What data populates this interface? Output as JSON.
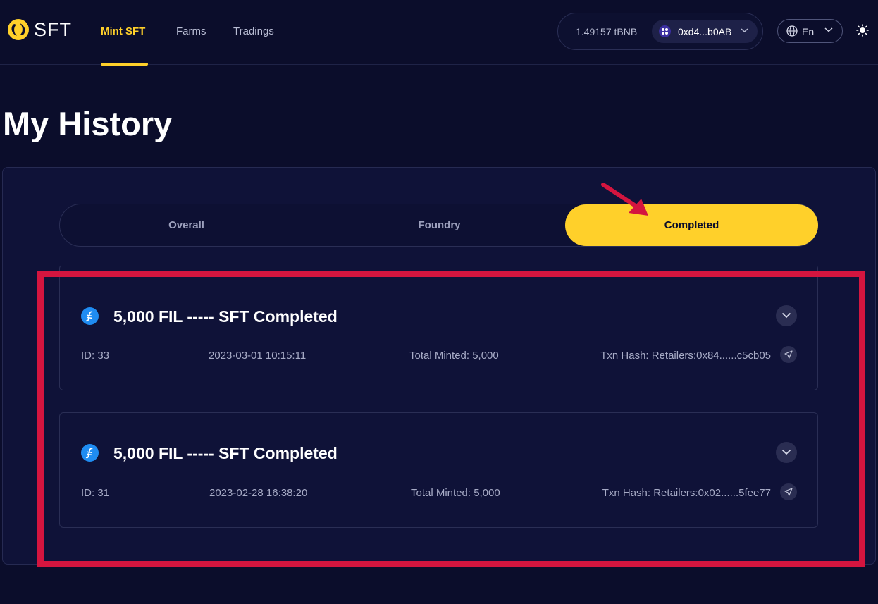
{
  "header": {
    "logo_text": "SFT",
    "nav": [
      {
        "label": "Mint SFT",
        "active": true
      },
      {
        "label": "Farms",
        "active": false
      },
      {
        "label": "Tradings",
        "active": false
      }
    ],
    "balance": "1.49157 tBNB",
    "address": "0xd4...b0AB",
    "language": "En",
    "accent_color": "#ffd02a"
  },
  "page": {
    "title": "My History"
  },
  "tabs": [
    {
      "label": "Overall",
      "active": false
    },
    {
      "label": "Foundry",
      "active": false
    },
    {
      "label": "Completed",
      "active": true
    }
  ],
  "records": [
    {
      "title": "5,000 FIL ----- SFT Completed",
      "id": "ID: 33",
      "datetime": "2023-03-01 10:15:11",
      "total_minted": "Total Minted: 5,000",
      "txn_hash": "Txn Hash: Retailers:0x84......c5cb05"
    },
    {
      "title": "5,000 FIL ----- SFT Completed",
      "id": "ID: 31",
      "datetime": "2023-02-28 16:38:20",
      "total_minted": "Total Minted: 5,000",
      "txn_hash": "Txn Hash: Retailers:0x02......5fee77"
    }
  ],
  "annotation_color": "#d4153f"
}
